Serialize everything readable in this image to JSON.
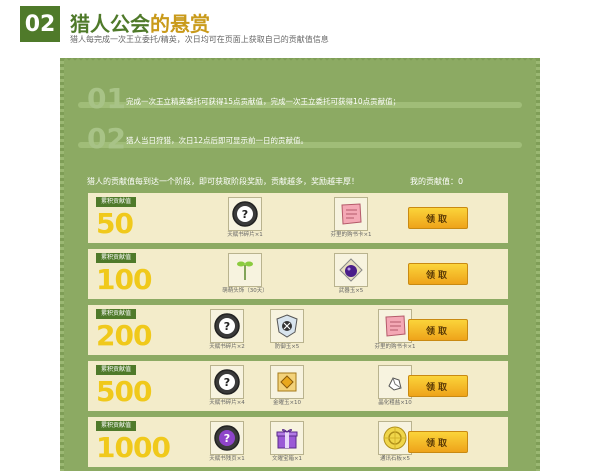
{
  "section": {
    "number": "02",
    "title_main": "猎人公会",
    "title_accent": "的悬赏",
    "subtitle": "猎人每完成一次王立委托/精英，次日均可在页面上获取自己的贡献值信息"
  },
  "rules": [
    {
      "num": "01",
      "text": "完成一次王立精英委托可获得15点贡献值，完成一次王立委托可获得10点贡献值；"
    },
    {
      "num": "02",
      "text": "猎人当日狩猎，次日12点后即可显示前一日的贡献值。"
    }
  ],
  "description": "猎人的贡献值每到达一个阶段，即可获取阶段奖励，贡献越多，奖励越丰厚！",
  "my_contribution": {
    "label": "我的贡献值：",
    "value": "0"
  },
  "tier_tag": "累积贡献值",
  "claim_label": "领取",
  "tiers": [
    {
      "value": "50",
      "items": [
        {
          "name": "天赋书碎片×1",
          "icon": "coin-question-icon"
        },
        {
          "name": "芬里的购书卡×1",
          "icon": "scroll-card-icon"
        }
      ]
    },
    {
      "value": "100",
      "items": [
        {
          "name": "萌萌头饰（30天）",
          "icon": "sprout-icon"
        },
        {
          "name": "武器玉×5",
          "icon": "purple-orb-icon"
        }
      ]
    },
    {
      "value": "200",
      "items": [
        {
          "name": "天赋书碎片×2",
          "icon": "coin-question-icon"
        },
        {
          "name": "防御玉×5",
          "icon": "shield-gem-icon"
        },
        {
          "name": "芬里的购书卡×1",
          "icon": "scroll-card-icon"
        }
      ]
    },
    {
      "value": "500",
      "items": [
        {
          "name": "天赋书碎片×4",
          "icon": "coin-question-icon"
        },
        {
          "name": "金曜玉×10",
          "icon": "gold-gem-icon"
        },
        {
          "name": "晶化粗盐×10",
          "icon": "crystal-salt-icon"
        }
      ]
    },
    {
      "value": "1000",
      "items": [
        {
          "name": "天赋书残页×1",
          "icon": "purple-coin-icon"
        },
        {
          "name": "文曜宝箱×1",
          "icon": "gift-box-icon"
        },
        {
          "name": "通讯石板×5",
          "icon": "gold-medallion-icon"
        }
      ]
    }
  ]
}
